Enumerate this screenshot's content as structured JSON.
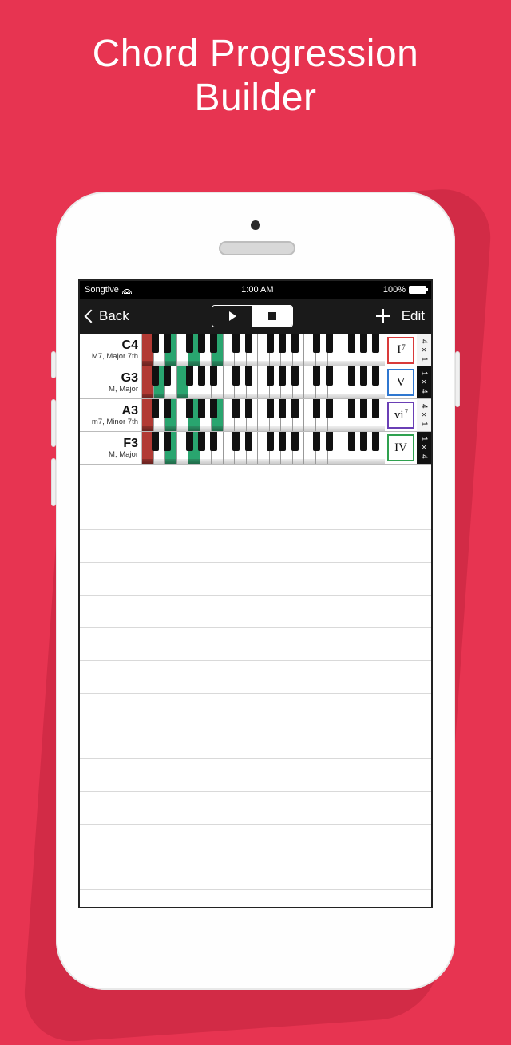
{
  "hero": {
    "line1": "Chord Progression",
    "line2": "Builder"
  },
  "status": {
    "carrier": "Songtive",
    "time": "1:00 AM",
    "battery": "100%"
  },
  "nav": {
    "back": "Back",
    "edit": "Edit"
  },
  "roman_colors": {
    "r0": "#d93a3a",
    "r1": "#2f77d0",
    "r2": "#6a3fb5",
    "r3": "#2fa14f"
  },
  "rows": [
    {
      "note": "C4",
      "quality": "M7, Major 7th",
      "roman": "I",
      "roman_sup": "7",
      "roman_color": "r0",
      "dur": "4 × 1",
      "dur_theme": "light",
      "hl": {
        "red_w": [
          1
        ],
        "green_w": [
          3,
          5,
          7
        ],
        "red_b": [],
        "green_b": []
      }
    },
    {
      "note": "G3",
      "quality": "M, Major",
      "roman": "V",
      "roman_sup": "",
      "roman_color": "r1",
      "dur": "1 × 4",
      "dur_theme": "dark",
      "hl": {
        "red_w": [
          1
        ],
        "green_w": [
          2,
          4
        ],
        "red_b": [],
        "green_b": []
      }
    },
    {
      "note": "A3",
      "quality": "m7, Minor 7th",
      "roman": "vi",
      "roman_sup": "7",
      "roman_color": "r2",
      "dur": "4 × 1",
      "dur_theme": "light",
      "hl": {
        "red_w": [
          1
        ],
        "green_w": [
          3,
          5,
          7
        ],
        "red_b": [],
        "green_b": []
      }
    },
    {
      "note": "F3",
      "quality": "M, Major",
      "roman": "IV",
      "roman_sup": "",
      "roman_color": "r3",
      "dur": "1 × 4",
      "dur_theme": "dark",
      "hl": {
        "red_w": [
          1
        ],
        "green_w": [
          3,
          5
        ],
        "red_b": [],
        "green_b": []
      }
    }
  ],
  "labels": {
    "note0": "C4",
    "qual0": "M7, Major 7th",
    "roman0": "I",
    "sup0": "7",
    "dur0": "4 × 1",
    "note1": "G3",
    "qual1": "M, Major",
    "roman1": "V",
    "sup1": "",
    "dur1": "1 × 4",
    "note2": "A3",
    "qual2": "m7, Minor 7th",
    "roman2": "vi",
    "sup2": "7",
    "dur2": "4 × 1",
    "note3": "F3",
    "qual3": "M, Major",
    "roman3": "IV",
    "sup3": "",
    "dur3": "1 × 4"
  }
}
